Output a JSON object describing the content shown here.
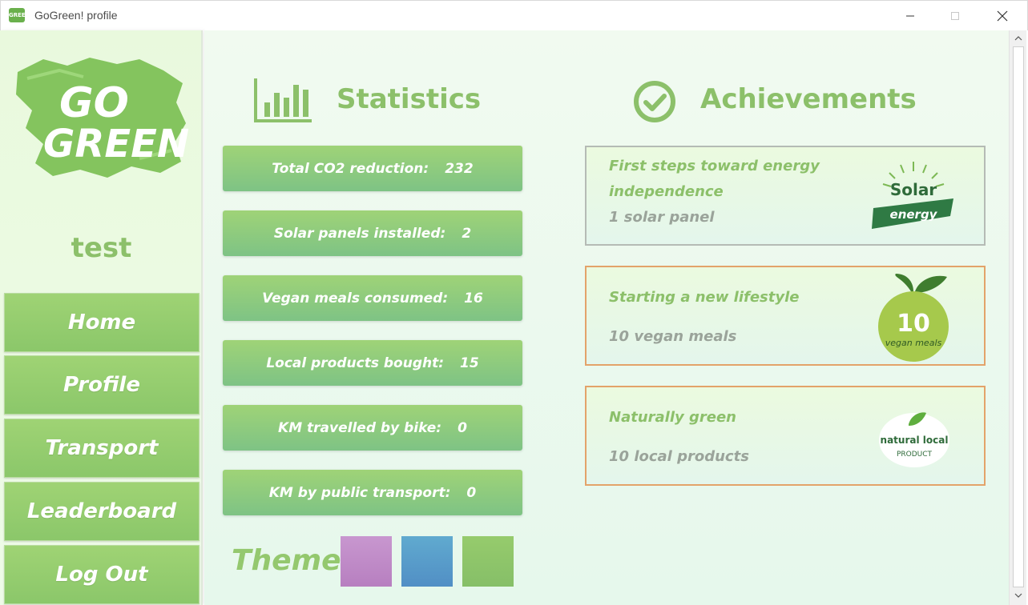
{
  "window": {
    "title": "GoGreen! profile",
    "icon_text": "GREEN"
  },
  "sidebar": {
    "logo_text_line1": "GO",
    "logo_text_line2": "GREEN",
    "username": "test",
    "nav": [
      {
        "label": "Home"
      },
      {
        "label": "Profile"
      },
      {
        "label": "Transport"
      },
      {
        "label": "Leaderboard"
      },
      {
        "label": "Log Out"
      }
    ]
  },
  "statistics": {
    "title": "Statistics",
    "icon": "bar-chart-icon",
    "items": [
      {
        "label": "Total CO2 reduction:",
        "value": "232"
      },
      {
        "label": "Solar panels installed:",
        "value": "2"
      },
      {
        "label": "Vegan meals consumed:",
        "value": "16"
      },
      {
        "label": "Local products bought:",
        "value": "15"
      },
      {
        "label": "KM travelled by bike:",
        "value": "0"
      },
      {
        "label": "KM by public transport:",
        "value": "0"
      }
    ]
  },
  "theme": {
    "label": "Theme",
    "swatches": [
      {
        "name": "purple",
        "color": "#c28ec8"
      },
      {
        "name": "blue",
        "color": "#5a9fce"
      },
      {
        "name": "green",
        "color": "#8fc66c"
      }
    ]
  },
  "achievements": {
    "title": "Achievements",
    "icon": "check-circle-icon",
    "items": [
      {
        "title_line1": "First steps toward energy",
        "title_line2": "independence",
        "subtitle": "1 solar panel",
        "badge_line1": "Solar",
        "badge_line2": "energy",
        "border": "#b5bbb5"
      },
      {
        "title_line1": "Starting a new lifestyle",
        "subtitle": "10 vegan meals",
        "badge_line1": "10",
        "badge_line2": "vegan meals",
        "border": "#e3a36a"
      },
      {
        "title_line1": "Naturally green",
        "subtitle": "10 local products",
        "badge_line1": "natural local",
        "badge_line2": "PRODUCT",
        "border": "#e3a36a"
      }
    ]
  },
  "colors": {
    "accent": "#8cc06a",
    "button": "#8bc76a",
    "achievement_border": "#e3a36a"
  }
}
